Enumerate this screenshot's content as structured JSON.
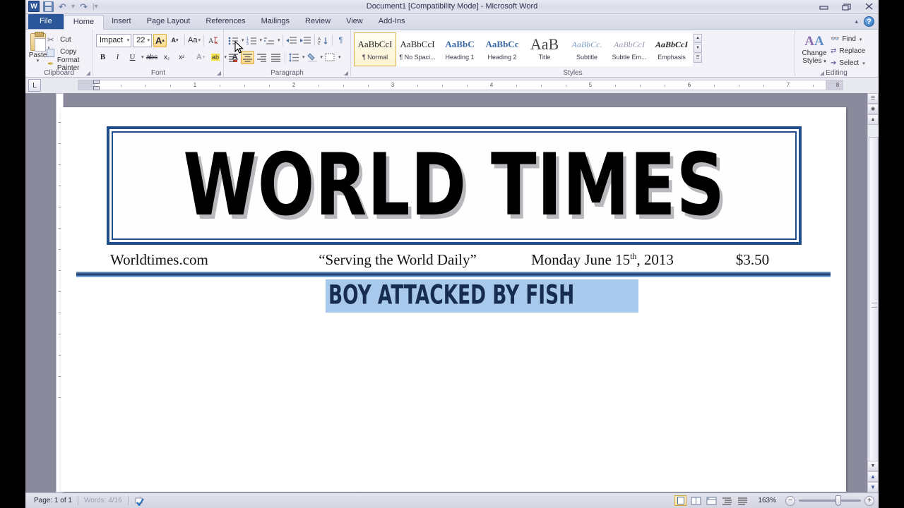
{
  "window": {
    "title": "Document1 [Compatibility Mode]  -  Microsoft Word",
    "app_logo": "W",
    "quick_access": [
      {
        "name": "save-icon",
        "label": "Save"
      },
      {
        "name": "undo-icon",
        "label": "↺"
      },
      {
        "name": "redo-icon",
        "label": "↻"
      },
      {
        "name": "customize-qat-icon",
        "label": "▾"
      }
    ],
    "controls": [
      {
        "name": "minimize-button",
        "glyph": "—"
      },
      {
        "name": "restore-button",
        "glyph": "❐"
      },
      {
        "name": "close-button",
        "glyph": "✕"
      }
    ],
    "ribbon_collapse": "▴",
    "help": "?"
  },
  "tabs": [
    {
      "label": "File",
      "type": "file"
    },
    {
      "label": "Home",
      "type": "active"
    },
    {
      "label": "Insert",
      "type": "normal"
    },
    {
      "label": "Page Layout",
      "type": "normal"
    },
    {
      "label": "References",
      "type": "normal"
    },
    {
      "label": "Mailings",
      "type": "normal"
    },
    {
      "label": "Review",
      "type": "normal"
    },
    {
      "label": "View",
      "type": "normal"
    },
    {
      "label": "Add-Ins",
      "type": "normal"
    }
  ],
  "ribbon": {
    "clipboard": {
      "group_label": "Clipboard",
      "paste_label": "Paste",
      "items": [
        {
          "label": "Cut",
          "icon": "scissors-icon"
        },
        {
          "label": "Copy",
          "icon": "copy-icon"
        },
        {
          "label": "Format Painter",
          "icon": "format-painter-icon"
        }
      ]
    },
    "font": {
      "group_label": "Font",
      "font_name": "Impact",
      "font_size": "22",
      "buttons": [
        {
          "name": "grow-font-button",
          "label": "A",
          "state": "hover"
        },
        {
          "name": "shrink-font-button",
          "label": "A",
          "state": "normal"
        },
        {
          "name": "change-case-button",
          "label": "Aa",
          "state": "normal"
        },
        {
          "name": "clear-formatting-button",
          "label": "A",
          "state": "normal"
        },
        {
          "name": "bold-button",
          "label": "B",
          "state": "normal"
        },
        {
          "name": "italic-button",
          "label": "I",
          "state": "normal"
        },
        {
          "name": "underline-button",
          "label": "U",
          "state": "normal"
        },
        {
          "name": "strikethrough-button",
          "label": "abc",
          "state": "normal"
        },
        {
          "name": "subscript-button",
          "label": "x",
          "state": "normal"
        },
        {
          "name": "superscript-button",
          "label": "x",
          "state": "normal"
        },
        {
          "name": "text-effects-button",
          "label": "A",
          "state": "disabled"
        },
        {
          "name": "text-highlight-button",
          "label": "ab",
          "state": "normal"
        },
        {
          "name": "font-color-button",
          "label": "A",
          "state": "normal"
        }
      ]
    },
    "paragraph": {
      "group_label": "Paragraph",
      "align_active": "center",
      "buttons": [
        {
          "name": "bullets-button"
        },
        {
          "name": "numbering-button"
        },
        {
          "name": "multilevel-list-button"
        },
        {
          "name": "decrease-indent-button"
        },
        {
          "name": "increase-indent-button"
        },
        {
          "name": "sort-button",
          "label": "A↓"
        },
        {
          "name": "show-formatting-marks-button",
          "label": "¶"
        },
        {
          "name": "align-left-button"
        },
        {
          "name": "align-center-button"
        },
        {
          "name": "align-right-button"
        },
        {
          "name": "justify-button"
        },
        {
          "name": "line-spacing-button"
        },
        {
          "name": "shading-button"
        },
        {
          "name": "borders-button"
        }
      ]
    },
    "styles": {
      "group_label": "Styles",
      "items": [
        {
          "preview": "AaBbCcI",
          "name": "¶ Normal",
          "selected": true,
          "cls": "s-normal"
        },
        {
          "preview": "AaBbCcI",
          "name": "¶ No Spaci...",
          "selected": false,
          "cls": "s-nospace"
        },
        {
          "preview": "AaBbC",
          "name": "Heading 1",
          "selected": false,
          "cls": "s-h1"
        },
        {
          "preview": "AaBbCc",
          "name": "Heading 2",
          "selected": false,
          "cls": "s-h2"
        },
        {
          "preview": "AaB",
          "name": "Title",
          "selected": false,
          "cls": "s-title"
        },
        {
          "preview": "AaBbCc.",
          "name": "Subtitle",
          "selected": false,
          "cls": "s-sub"
        },
        {
          "preview": "AaBbCcI",
          "name": "Subtle Em...",
          "selected": false,
          "cls": "s-subem"
        },
        {
          "preview": "AaBbCcI",
          "name": "Emphasis",
          "selected": false,
          "cls": "s-emph"
        }
      ]
    },
    "editing": {
      "group_label": "Editing",
      "change_styles_label": "Change",
      "change_styles_label2": "Styles",
      "items": [
        {
          "label": "Find",
          "icon": "binoculars-icon",
          "has_arrow": true
        },
        {
          "label": "Replace",
          "icon": "replace-icon",
          "has_arrow": false
        },
        {
          "label": "Select",
          "icon": "select-icon",
          "has_arrow": true
        }
      ]
    }
  },
  "ruler": {
    "tab_selector": "L",
    "marks": [
      "1",
      "2",
      "3",
      "4",
      "5",
      "6",
      "7",
      "8"
    ]
  },
  "document": {
    "masthead_title": "WORLD TIMES",
    "byline": {
      "website": "Worldtimes.com",
      "slogan": "“Serving the World Daily”",
      "date_main": "Monday June 15",
      "date_sup": "th",
      "date_rest": ", 2013",
      "price": "$3.50"
    },
    "headline": "BOY ATTACKED BY FISH"
  },
  "statusbar": {
    "page": "Page: 1 of 1",
    "words": "Words: 4/16",
    "proofing_icon": "proofing-errors-icon",
    "views": [
      {
        "name": "print-layout-view-button",
        "active": true
      },
      {
        "name": "full-screen-reading-view-button",
        "active": false
      },
      {
        "name": "web-layout-view-button",
        "active": false
      },
      {
        "name": "outline-view-button",
        "active": false
      },
      {
        "name": "draft-view-button",
        "active": false
      }
    ],
    "zoom": "163%",
    "zoom_out": "−",
    "zoom_in": "+"
  },
  "colors": {
    "accent_blue": "#2b579a",
    "masthead_border": "#1f4e8c",
    "headline_text": "#162c50",
    "selection": "#a9c9ec"
  }
}
